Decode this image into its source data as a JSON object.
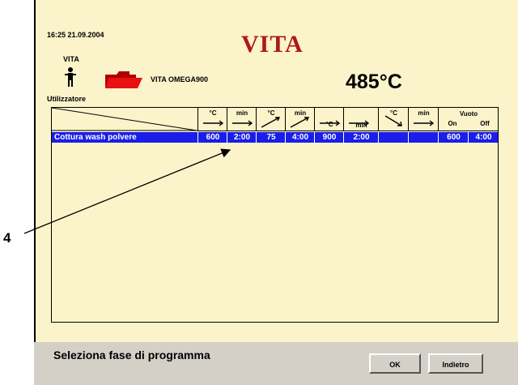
{
  "header": {
    "datetime": "16:25  21.09.2004",
    "brand": "VITA",
    "user_name": "VITA",
    "program_name": "VITA OMEGA900",
    "temperature": "485°C",
    "user_label": "Utilizzatore"
  },
  "table": {
    "columns": [
      {
        "id": "temp1",
        "unit": "°C",
        "icon": "right-arrow-icon"
      },
      {
        "id": "time1",
        "unit": "min",
        "icon": "right-arrow-icon"
      },
      {
        "id": "rate",
        "unit": "°C",
        "icon": "up-right-arrow-icon"
      },
      {
        "id": "time2",
        "unit": "min",
        "icon": "up-right-arrow-icon"
      },
      {
        "id": "temp2",
        "unit": "°C",
        "icon": "right-arrow-icon"
      },
      {
        "id": "time3",
        "unit": "min",
        "icon": "right-arrow-icon"
      },
      {
        "id": "cool",
        "unit": "°C",
        "icon": "down-right-arrow-icon"
      },
      {
        "id": "time4",
        "unit": "min",
        "icon": "right-arrow-icon"
      }
    ],
    "vacuum": {
      "title": "Vuoto",
      "on": "On",
      "off": "Off"
    },
    "rows": [
      {
        "name": "Cottura wash polvere",
        "values": [
          "600",
          "2:00",
          "75",
          "4:00",
          "900",
          "2:00",
          "",
          ""
        ],
        "vac_on": "600",
        "vac_off": "4:00"
      }
    ]
  },
  "status_text": "Seleziona fase di programma",
  "buttons": {
    "ok": "OK",
    "back": "Indietro"
  },
  "callout_label": "4",
  "colors": {
    "background": "#fbf4cb",
    "selection": "#1a1ee8",
    "brand": "#b01818",
    "folder": "#e01010",
    "bar": "#d4d0c8"
  }
}
